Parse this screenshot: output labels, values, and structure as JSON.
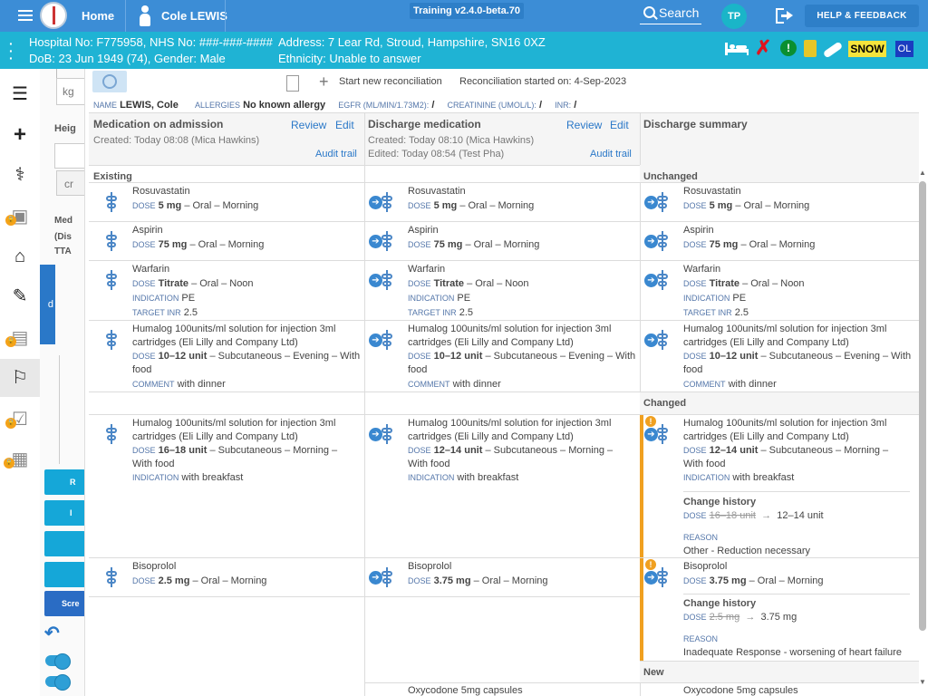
{
  "topbar": {
    "home_label": "Home",
    "patient_name": "Cole LEWIS",
    "training_label": "Training v2.4.0-beta.70",
    "search_label": "Search",
    "avatar_initials": "TP",
    "help_label": "HELP & FEEDBACK"
  },
  "patient_bar": {
    "hospital_no": "Hospital No: F775958, NHS No: ###-###-####",
    "dob": "DoB: 23 Jun 1949 (74), Gender: Male",
    "address": "Address: 7 Lear Rd, Stroud, Hampshire, SN16 0XZ",
    "ethnicity": "Ethnicity: Unable to answer",
    "snow_label": "SNOW",
    "ol_label": "OL"
  },
  "left_panel": {
    "kg_text": "kg",
    "height_label": "Heig",
    "cm_text": "cr",
    "med_label_1": "Med",
    "med_label_2": "(Dis",
    "med_label_3": "TTA",
    "blue_tab_label": "d",
    "btn1": "R",
    "btn2": "I",
    "btn3": "",
    "btn4": "",
    "btn5": "Scre"
  },
  "reconciliation": {
    "start_new_label": "Start new reconciliation",
    "started_on": "Reconciliation started on: 4-Sep-2023"
  },
  "patient_info": {
    "name_label": "NAME",
    "name_value": "LEWIS, Cole",
    "allergies_label": "ALLERGIES",
    "allergies_value": "No known allergy",
    "egfr_label": "EGFR (ML/MIN/1.73M2):",
    "egfr_value": "/",
    "creatinine_label": "CREATININE (UMOL/L):",
    "creatinine_value": "/",
    "inr_label": "INR:",
    "inr_value": "/"
  },
  "columns": {
    "admission": {
      "title": "Medication on admission",
      "review": "Review",
      "edit": "Edit",
      "created": "Created: Today 08:08 (Mica Hawkins)",
      "audit": "Audit trail"
    },
    "discharge": {
      "title": "Discharge medication",
      "review": "Review",
      "edit": "Edit",
      "created": "Created: Today 08:10 (Mica Hawkins)",
      "edited": "Edited: Today 08:54 (Test Pha)",
      "audit": "Audit trail"
    },
    "summary": {
      "title": "Discharge summary"
    }
  },
  "sections": {
    "existing": "Existing",
    "unchanged": "Unchanged",
    "changed": "Changed",
    "new": "New"
  },
  "labels": {
    "dose": "DOSE",
    "indication": "INDICATION",
    "target_inr": "TARGET INR",
    "comment": "COMMENT",
    "change_history": "Change history",
    "reason": "REASON"
  },
  "meds": {
    "rosuvastatin": {
      "name": "Rosuvastatin",
      "dose": "5 mg",
      "route": "– Oral – Morning"
    },
    "aspirin": {
      "name": "Aspirin",
      "dose": "75 mg",
      "route": "– Oral – Morning"
    },
    "warfarin": {
      "name": "Warfarin",
      "dose": "Titrate",
      "route": "– Oral – Noon",
      "indication": "PE",
      "target_inr": "2.5"
    },
    "humalog_evening": {
      "name": "Humalog 100units/ml solution for injection 3ml",
      "name2": "cartridges (Eli Lilly and Company Ltd)",
      "dose": "10–12 unit",
      "route": "– Subcutaneous – Evening – With",
      "route2": "food",
      "comment": "with dinner"
    },
    "humalog_morning_admission": {
      "name": "Humalog 100units/ml solution for injection 3ml",
      "name2": "cartridges (Eli Lilly and Company Ltd)",
      "dose": "16–18 unit",
      "route": "– Subcutaneous – Morning –",
      "route2": "With food",
      "indication": "with breakfast"
    },
    "humalog_morning_discharge": {
      "name": "Humalog 100units/ml solution for injection 3ml",
      "name2": "cartridges (Eli Lilly and Company Ltd)",
      "dose": "12–14 unit",
      "route": "– Subcutaneous – Morning –",
      "route2": "With food",
      "indication": "with breakfast",
      "old_dose": "16–18 unit",
      "new_dose": "12–14 unit",
      "reason": "Other - Reduction necessary"
    },
    "bisoprolol_admission": {
      "name": "Bisoprolol",
      "dose": "2.5 mg",
      "route": "– Oral – Morning"
    },
    "bisoprolol_discharge": {
      "name": "Bisoprolol",
      "dose": "3.75 mg",
      "route": "– Oral – Morning",
      "old_dose": "2.5 mg",
      "new_dose": "3.75 mg",
      "reason": "Inadequate Response - worsening of heart failure"
    },
    "oxycodone": {
      "name": "Oxycodone 5mg capsules"
    }
  }
}
